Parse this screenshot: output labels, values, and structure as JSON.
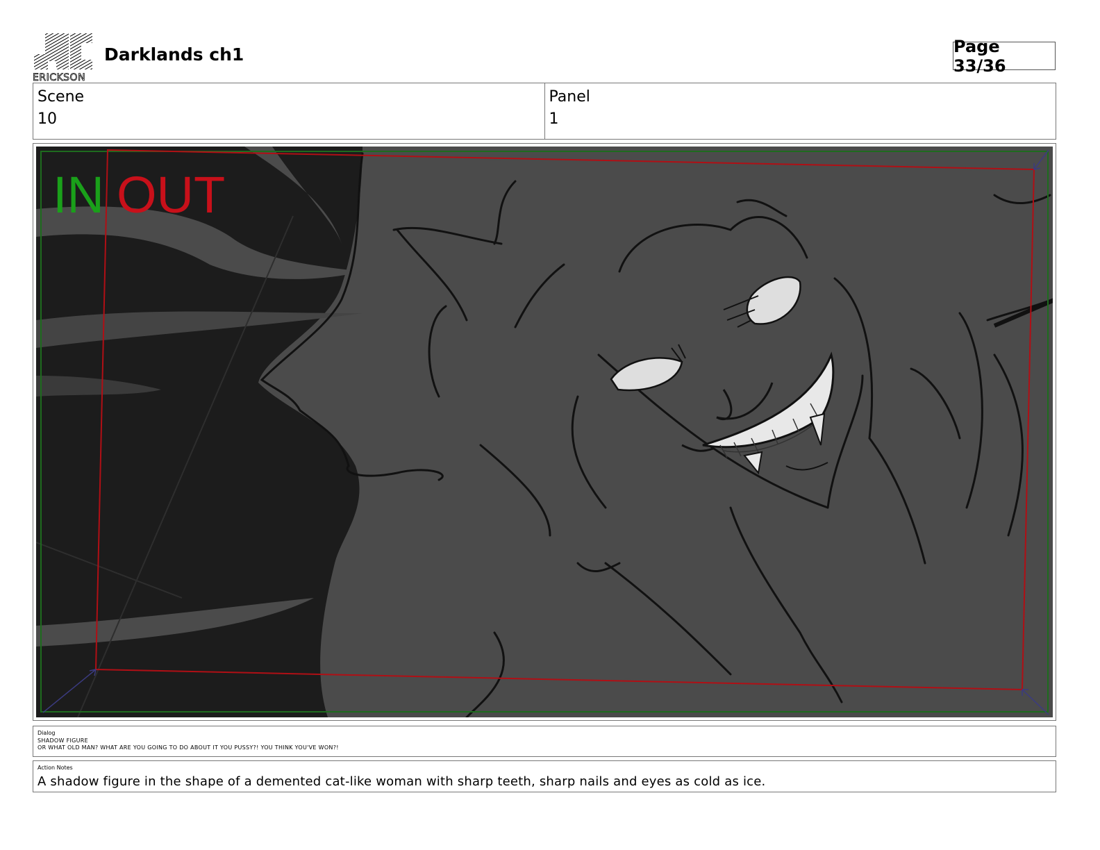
{
  "header": {
    "logo_text": "ERICKSON",
    "title": "Darklands ch1",
    "page_label": "Page 33/36"
  },
  "meta": {
    "scene_label": "Scene",
    "scene_value": "10",
    "panel_label": "Panel",
    "panel_value": "1"
  },
  "frame": {
    "in_label": "IN",
    "out_label": "OUT",
    "in_color": "#1aa01a",
    "out_color": "#c8101a",
    "background_color": "#4b4b4b"
  },
  "dialog": {
    "label": "Dialog",
    "character": "SHADOW FIGURE",
    "line": "OR WHAT OLD MAN? WHAT ARE YOU GOING TO DO ABOUT IT YOU PUSSY?! YOU THINK YOU'VE WON?!"
  },
  "action_notes": {
    "label": "Action Notes",
    "text": "A shadow figure in the shape of a demented cat-like woman with sharp teeth, sharp nails and eyes as cold as ice."
  }
}
